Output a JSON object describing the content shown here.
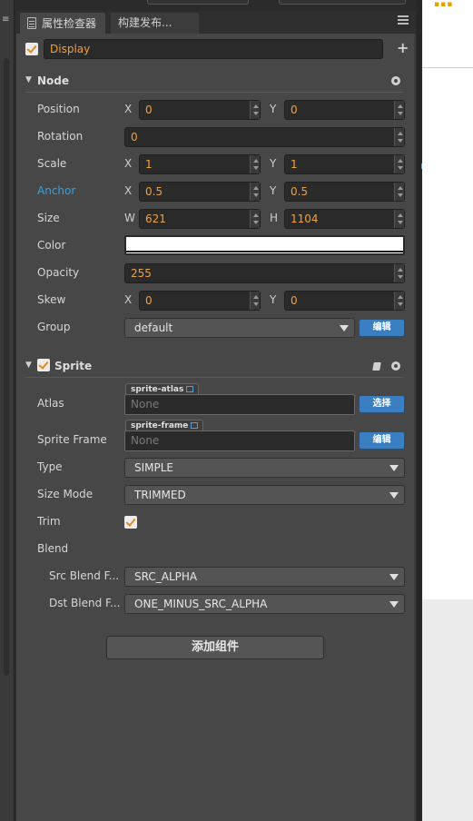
{
  "tabs": [
    {
      "label": "属性检查器",
      "active": true
    },
    {
      "label": "构建发布...",
      "active": false
    }
  ],
  "node_name": "Display",
  "node_section": {
    "title": "Node",
    "position": {
      "x_label": "X",
      "x": "0",
      "y_label": "Y",
      "y": "0",
      "label": "Position"
    },
    "rotation": {
      "label": "Rotation",
      "value": "0"
    },
    "scale": {
      "label": "Scale",
      "x_label": "X",
      "x": "1",
      "y_label": "Y",
      "y": "1"
    },
    "anchor": {
      "label": "Anchor",
      "x_label": "X",
      "x": "0.5",
      "y_label": "Y",
      "y": "0.5"
    },
    "size": {
      "label": "Size",
      "w_label": "W",
      "w": "621",
      "h_label": "H",
      "h": "1104"
    },
    "color": {
      "label": "Color",
      "value": "#ffffff"
    },
    "opacity": {
      "label": "Opacity",
      "value": "255"
    },
    "skew": {
      "label": "Skew",
      "x_label": "X",
      "x": "0",
      "y_label": "Y",
      "y": "0"
    },
    "group": {
      "label": "Group",
      "value": "default",
      "edit_label": "编辑"
    }
  },
  "sprite_section": {
    "title": "Sprite",
    "atlas": {
      "label": "Atlas",
      "tag": "sprite-atlas",
      "value": "None",
      "button": "选择"
    },
    "sprite_frame": {
      "label": "Sprite Frame",
      "tag": "sprite-frame",
      "value": "None",
      "button": "编辑"
    },
    "type": {
      "label": "Type",
      "value": "SIMPLE"
    },
    "size_mode": {
      "label": "Size Mode",
      "value": "TRIMMED"
    },
    "trim": {
      "label": "Trim",
      "checked": true
    },
    "blend": {
      "label": "Blend"
    },
    "src_blend": {
      "label": "Src Blend F...",
      "value": "SRC_ALPHA"
    },
    "dst_blend": {
      "label": "Dst Blend F...",
      "value": "ONE_MINUS_SRC_ALPHA"
    }
  },
  "add_component_label": "添加组件",
  "colors": {
    "accent_orange": "#f0a040",
    "anchor_blue": "#3a9fe0",
    "button_blue": "#3a7fc1",
    "panel_bg": "#474747"
  }
}
